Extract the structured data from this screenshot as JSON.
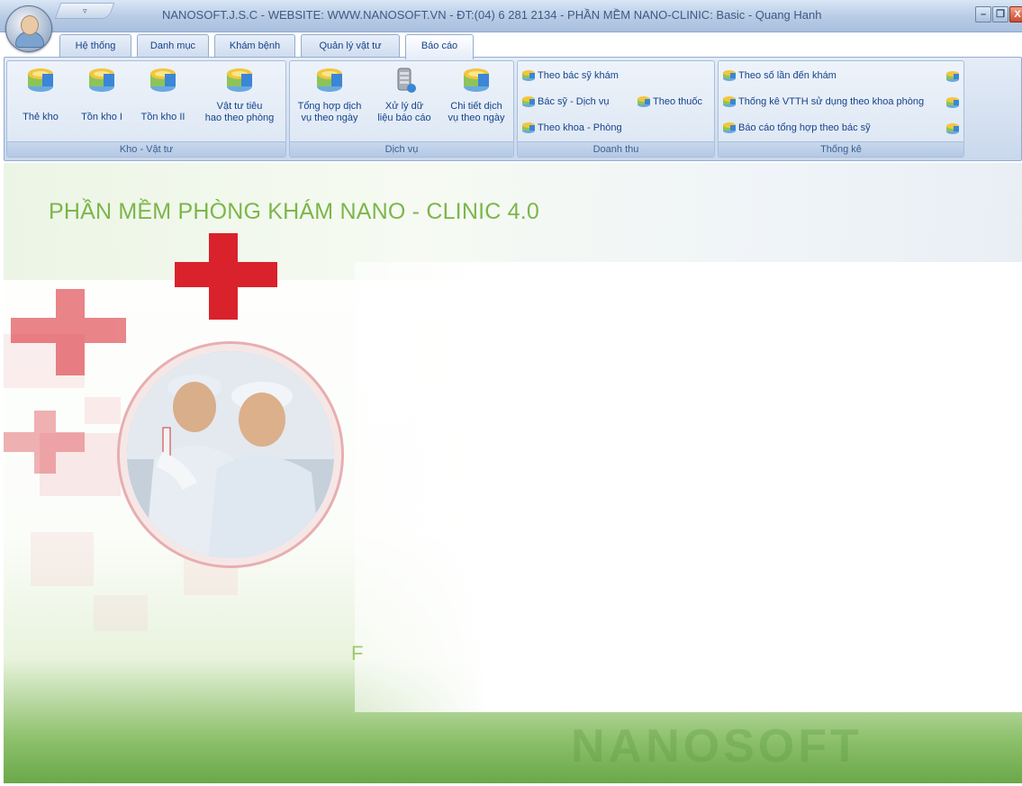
{
  "window": {
    "qat_glyph": "▿",
    "title": "NANOSOFT.J.S.C - WEBSITE: WWW.NANOSOFT.VN - ĐT:(04) 6 281 2134 - PHẦN MỀM NANO-CLINIC: Basic - Quang Hanh",
    "min_glyph": "–",
    "max_glyph": "❐",
    "close_glyph": "X"
  },
  "tabs": [
    {
      "label": "Hệ thống",
      "active": false
    },
    {
      "label": "Danh mục",
      "active": false
    },
    {
      "label": "Khám bệnh",
      "active": false
    },
    {
      "label": "Quản lý vật tư",
      "active": false
    },
    {
      "label": "Báo cáo",
      "active": true
    }
  ],
  "ribbon": {
    "kho_vat_tu": {
      "caption": "Kho - Vật tư",
      "buttons": [
        {
          "line1": "Thẻ kho",
          "line2": ""
        },
        {
          "line1": "Tồn kho I",
          "line2": ""
        },
        {
          "line1": "Tồn kho II",
          "line2": ""
        },
        {
          "line1": "Vật tư tiêu",
          "line2": "hao theo phòng"
        }
      ]
    },
    "dich_vu": {
      "caption": "Dịch vụ",
      "buttons": [
        {
          "line1": "Tổng hợp dịch",
          "line2": "vụ theo ngày"
        },
        {
          "line1": "Xử lý dữ",
          "line2": "liệu báo cáo"
        },
        {
          "line1": "Chi tiết dịch",
          "line2": "vụ theo ngày"
        }
      ]
    },
    "doanh_thu": {
      "caption": "Doanh thu",
      "items": [
        "Theo bác sỹ khám",
        "Bác sỹ - Dịch vụ",
        "Theo thuốc",
        "Theo khoa - Phòng"
      ]
    },
    "thong_ke": {
      "caption": "Thống kê",
      "items": [
        "Theo số lần đến khám",
        "Thống kê VTTH sử dụng theo khoa phòng",
        "Báo cáo tổng hợp theo bác sỹ"
      ]
    }
  },
  "content": {
    "headline": "PHẦN MỀM PHÒNG KHÁM NANO - CLINIC 4.0",
    "partial_letter": "F",
    "watermark": "NANOSOFT"
  },
  "colors": {
    "headline": "#7cb64a",
    "cross": "#d9222c",
    "ribbon_text": "#15428b"
  }
}
